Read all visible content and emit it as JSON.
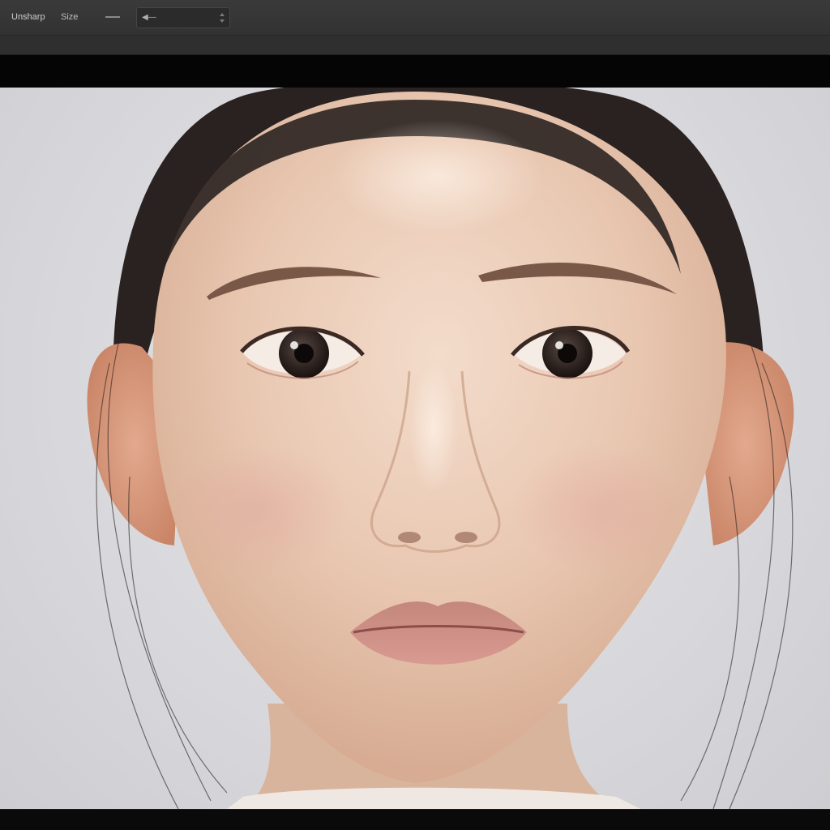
{
  "toolbar": {
    "primary_label": "Unsharp",
    "secondary_label": "Size"
  },
  "icons": {
    "options_arrow": "arrow-left-icon",
    "spinner": "spinner-arrows-icon"
  },
  "colors": {
    "toolbar_bg": "#353535",
    "panel_bg": "#050505",
    "canvas_bg": "#dcdce0",
    "skin": "#e8c9b4",
    "hair": "#2a2220",
    "lips": "#c98c82"
  }
}
